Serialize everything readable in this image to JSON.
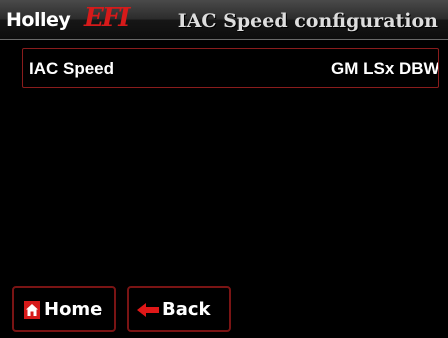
{
  "header": {
    "logo_holley": "Holley",
    "logo_efi": "EFI",
    "title": "IAC Speed configuration"
  },
  "setting": {
    "label": "IAC Speed",
    "value": "GM LSx DBW"
  },
  "buttons": {
    "home_label": "Home",
    "home_icon": "home-icon",
    "back_label": "Back",
    "back_icon": "back-arrow-icon"
  },
  "colors": {
    "accent": "#d61a1a",
    "border": "#8a1c1c",
    "background": "#000000"
  }
}
